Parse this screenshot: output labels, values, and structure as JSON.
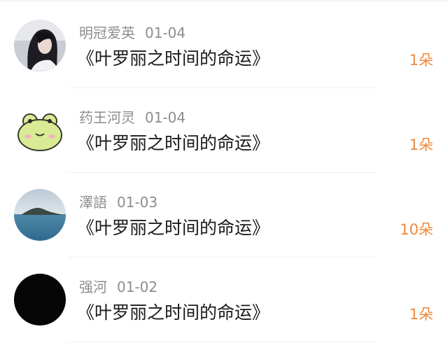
{
  "records": [
    {
      "user": "明冠爱英",
      "date": "01-04",
      "title": "《叶罗丽之时间的命运》",
      "count": "1朵",
      "avatar_icon": "girl-photo-avatar"
    },
    {
      "user": "药王河灵",
      "date": "01-04",
      "title": "《叶罗丽之时间的命运》",
      "count": "1朵",
      "avatar_icon": "frog-avatar"
    },
    {
      "user": "澤語",
      "date": "01-03",
      "title": "《叶罗丽之时间的命运》",
      "count": "10朵",
      "avatar_icon": "lake-landscape-avatar"
    },
    {
      "user": "强河",
      "date": "01-02",
      "title": "《叶罗丽之时间的命运》",
      "count": "1朵",
      "avatar_icon": "black-avatar"
    }
  ],
  "colors": {
    "username": "#8d8d8d",
    "title": "#1a1a1a",
    "count": "#f0893a",
    "divider": "#f1f1f1"
  }
}
